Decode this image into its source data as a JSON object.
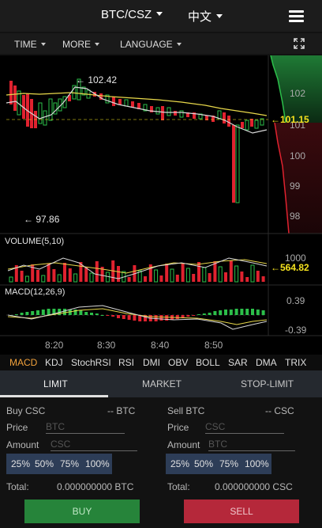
{
  "header": {
    "pair": "BTC/CSZ",
    "language": "中文"
  },
  "toolbar": {
    "time": "TIME",
    "more": "MORE",
    "language": "LANGUAGE"
  },
  "chart": {
    "price_high_label": "← 102.42",
    "price_low_label": "← 97.86",
    "current_price": "101.15",
    "price_ticks": [
      "102",
      "101",
      "100",
      "99",
      "98"
    ],
    "volume_label": "VOLUME(5,10)",
    "volume_ticks": [
      "1000"
    ],
    "volume_current": "564.82",
    "macd_label": "MACD(12,26,9)",
    "macd_ticks": [
      "0.39",
      "-0.39"
    ],
    "time_ticks": [
      "8:20",
      "8:30",
      "8:40",
      "8:50"
    ],
    "colors": {
      "up": "#2cbf4a",
      "down": "#e0222f",
      "ma_yellow": "#e8d84a",
      "ma_white": "#d8d8d8",
      "price_badge": "#f5e21e"
    }
  },
  "indicators": [
    "MACD",
    "KDJ",
    "StochRSI",
    "RSI",
    "DMI",
    "OBV",
    "BOLL",
    "SAR",
    "DMA",
    "TRIX"
  ],
  "tabs": [
    "LIMIT",
    "MARKET",
    "STOP-LIMIT"
  ],
  "buy": {
    "title": "Buy CSC",
    "balance": "-- BTC",
    "price_label": "Price",
    "price_placeholder": "BTC",
    "amount_label": "Amount",
    "amount_placeholder": "CSC",
    "percents": [
      "25%",
      "50%",
      "75%",
      "100%"
    ],
    "total_label": "Total:",
    "total_value": "0.000000000 BTC",
    "button": "BUY"
  },
  "sell": {
    "title": "Sell BTC",
    "balance": "-- CSC",
    "price_label": "Price",
    "price_placeholder": "CSC",
    "amount_label": "Amount",
    "amount_placeholder": "BTC",
    "percents": [
      "25%",
      "50%",
      "75%",
      "100%"
    ],
    "total_label": "Total:",
    "total_value": "0.000000000 CSC",
    "button": "SELL"
  }
}
